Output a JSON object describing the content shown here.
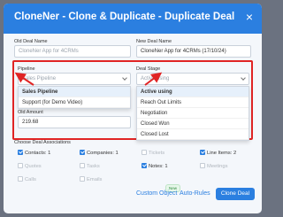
{
  "modal": {
    "title": "CloneNer - Clone & Duplicate - Duplicate Deal",
    "close_icon": "×"
  },
  "form": {
    "old_deal_name": {
      "label": "Old Deal Name",
      "value": "CloneNer App for 4CRMs"
    },
    "new_deal_name": {
      "label": "New Deal Name",
      "value": "CloneNer App for 4CRMs (17/10/24)"
    },
    "pipeline": {
      "label": "Pipeline",
      "placeholder": "Sales Pipeline",
      "options": [
        "Sales Pipeline",
        "Support (for Demo Video)"
      ]
    },
    "deal_stage": {
      "label": "Deal Stage",
      "placeholder": "Active using",
      "options": [
        "Active using",
        "Reach Out Limits",
        "Negotiation",
        "Closed Won",
        "Closed Lost"
      ]
    },
    "old_amount": {
      "label": "Old Amount",
      "value": "219.68"
    }
  },
  "associations": {
    "label": "Choose Deal Associations",
    "row1": [
      {
        "label": "Contacts: 1",
        "checked": true
      },
      {
        "label": "Companies: 1",
        "checked": true
      },
      {
        "label": "Tickets",
        "checked": false
      },
      {
        "label": "Line Items: 2",
        "checked": true
      }
    ],
    "row2": [
      {
        "label": "Quotes",
        "checked": false
      },
      {
        "label": "Tasks",
        "checked": false
      },
      {
        "label": "Notes: 1",
        "checked": true
      },
      {
        "label": "Meetings",
        "checked": false
      }
    ],
    "row3": [
      {
        "label": "Calls",
        "checked": false
      },
      {
        "label": "Emails",
        "checked": false
      }
    ]
  },
  "footer": {
    "new_badge": "New",
    "custom_object": "Custom Object",
    "auto_rules": "Auto-Rules",
    "clone_deal": "Clone Deal"
  },
  "colors": {
    "accent": "#2b7fe0",
    "highlight_box": "#e02424"
  }
}
